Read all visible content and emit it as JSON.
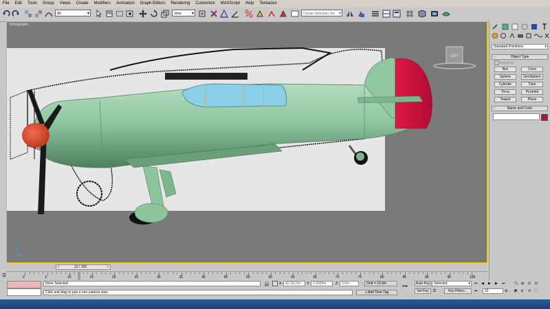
{
  "menu": [
    "File",
    "Edit",
    "Tools",
    "Group",
    "Views",
    "Create",
    "Modifiers",
    "Animation",
    "Graph Editors",
    "Rendering",
    "Customize",
    "MAXScript",
    "Help",
    "Tentacles"
  ],
  "toolbar": {
    "selection_filter": "All",
    "reference_coord": "View",
    "named_selection_placeholder": "Create Selection Set"
  },
  "viewport": {
    "label": "Orthographic",
    "viewcube_label": "LEFT"
  },
  "command_panel": {
    "category_dropdown": "Standard Primitives",
    "object_type_header": "Object Type",
    "autogrid_label": "AutoGrid",
    "buttons": [
      "Box",
      "Cone",
      "Sphere",
      "GeoSphere",
      "Cylinder",
      "Tube",
      "Torus",
      "Pyramid",
      "Teapot",
      "Plane"
    ],
    "name_color_header": "Name and Color",
    "object_color": "#a0203c"
  },
  "time": {
    "slider_label": "12 / 100",
    "ticks": [
      "0",
      "5",
      "10",
      "15",
      "20",
      "25",
      "30",
      "35",
      "40",
      "45",
      "50",
      "55",
      "60",
      "65",
      "70",
      "75",
      "80",
      "85",
      "90",
      "95",
      "100"
    ]
  },
  "status": {
    "selection_text": "None Selected",
    "prompt_text": "Click and drag to pan a non-camera view",
    "x_label": "X:",
    "x_value": "42.1167m",
    "y_label": "Y:",
    "y_value": "2.6099m",
    "z_label": "Z:",
    "z_value": "0.0m",
    "grid_text": "Grid = 10.0m",
    "add_time_tag": "Add Time Tag",
    "auto_key": "Auto Key",
    "auto_key_select": "Selected",
    "set_key": "Set Key",
    "key_filters": "Key Filters...",
    "frame_value": "12"
  },
  "colors": {
    "fuselage": "#8fc7a0",
    "tail": "#d4103f",
    "nose": "#e04a2a",
    "canopy": "#8ccfe8",
    "accent": "#e6c200"
  }
}
